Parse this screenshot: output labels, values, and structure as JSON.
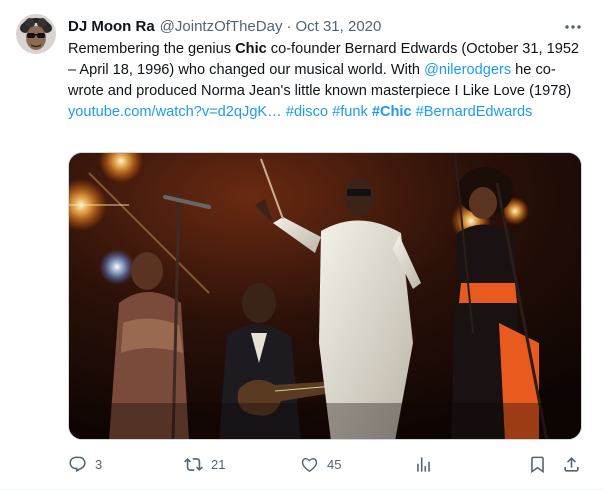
{
  "tweet": {
    "display_name": "DJ Moon Ra",
    "handle": "@JointzOfTheDay",
    "separator": "·",
    "date": "Oct 31, 2020",
    "text": {
      "t1": "Remembering the genius ",
      "bold_chic": "Chic",
      "t2": " co-founder Bernard Edwards (October 31, 1952 – April 18, 1996) who changed our musical world. With ",
      "mention": "@nilerodgers",
      "t3": " he co-wrote and produced Norma Jean's little known masterpiece I Like Love (1978) ",
      "link": "youtube.com/watch?v=d2qJgK…",
      "sp1": " ",
      "tag_disco": "#disco",
      "sp2": " ",
      "tag_funk": "#funk",
      "sp3": " ",
      "tag_chic": "#Chic",
      "sp4": " ",
      "tag_bernard": "#BernardEdwards"
    }
  },
  "actions": {
    "reply": {
      "icon": "reply-icon",
      "count": "3"
    },
    "retweet": {
      "icon": "retweet-icon",
      "count": "21"
    },
    "like": {
      "icon": "like-icon",
      "count": "45"
    },
    "views": {
      "icon": "analytics-icon"
    },
    "bookmark": {
      "icon": "bookmark-icon"
    },
    "share": {
      "icon": "share-icon"
    }
  },
  "colors": {
    "accent": "#1d9bf0",
    "text_primary": "#0f1419",
    "text_secondary": "#536471"
  }
}
